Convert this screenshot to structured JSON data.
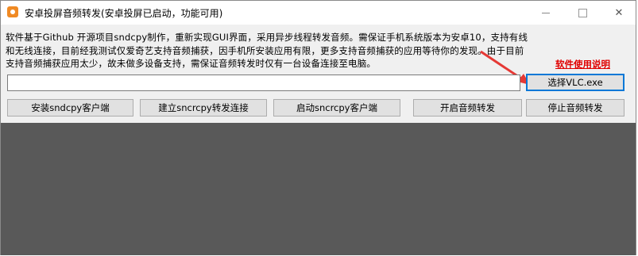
{
  "window": {
    "title": "安卓投屏音频转发(安卓投屏已启动，功能可用)",
    "controls": {
      "minimize": "—",
      "maximize": "☐",
      "close": "✕"
    }
  },
  "description": {
    "line1": "软件基于Github 开源项目sndcpy制作，重新实现GUI界面，采用异步线程转发音频。需保证手机系统版本为安卓10，支持有线",
    "line2": "和无线连接，目前经我测试仅爱奇艺支持音频捕获，因手机所安装应用有限，更多支持音频捕获的应用等待你的发现。由于目前",
    "line3": "支持音频捕获应用太少，故未做多设备支持，需保证音频转发时仅有一台设备连接至电脑。"
  },
  "help_link": "软件使用说明",
  "path_input": {
    "value": "",
    "placeholder": ""
  },
  "buttons": {
    "select_vlc": "选择VLC.exe",
    "install_client": "安装sndcpy客户端",
    "establish_forward": "建立sncrcpy转发连接",
    "start_client": "启动sncrcpy客户端",
    "start_audio": "开启音频转发",
    "stop_audio": "停止音频转发"
  },
  "colors": {
    "help_link": "#e00000",
    "arrow": "#e53935",
    "dark_area": "#595959",
    "focus_border": "#0078d7"
  }
}
